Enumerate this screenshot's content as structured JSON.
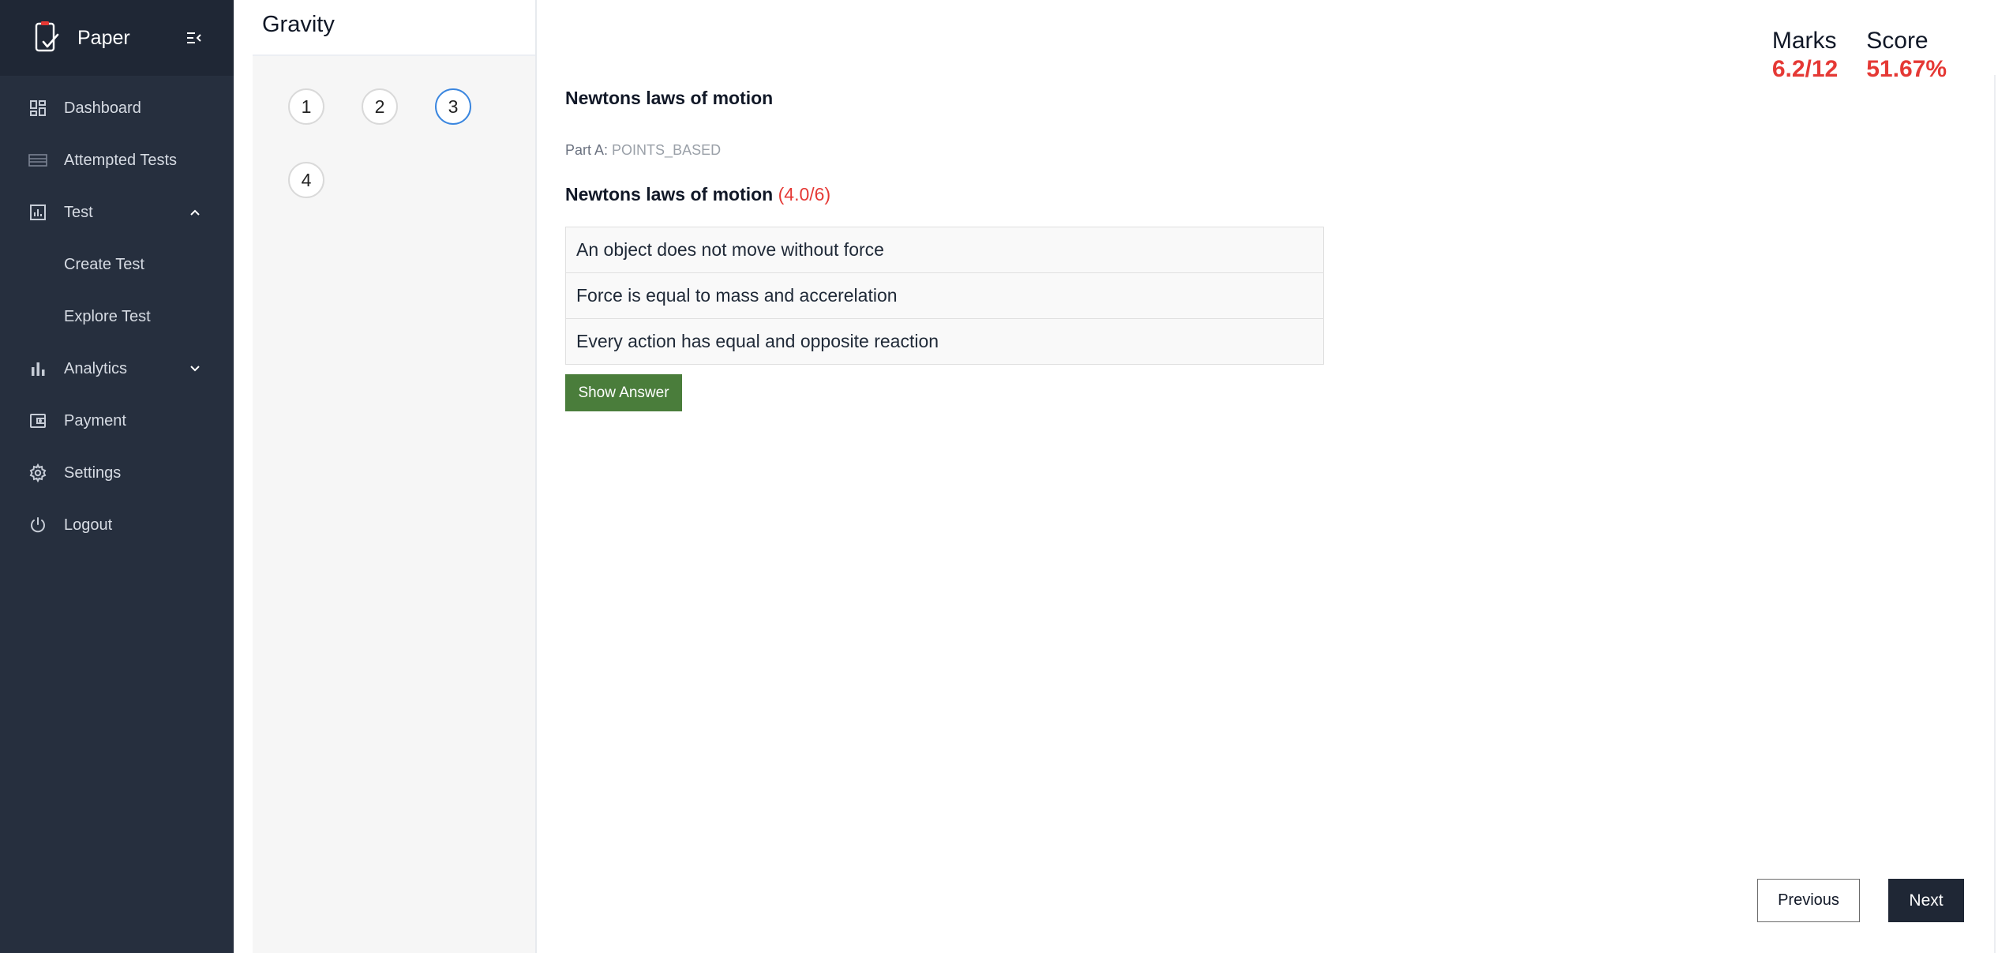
{
  "app": {
    "name": "Paper"
  },
  "sidebar": {
    "items": [
      {
        "label": "Dashboard",
        "icon": "dashboard-icon"
      },
      {
        "label": "Attempted Tests",
        "icon": "list-icon"
      },
      {
        "label": "Test",
        "icon": "bar-chart-box-icon",
        "expanded": true,
        "children": [
          {
            "label": "Create Test"
          },
          {
            "label": "Explore Test"
          }
        ]
      },
      {
        "label": "Analytics",
        "icon": "bar-chart-icon",
        "expanded": false
      },
      {
        "label": "Payment",
        "icon": "wallet-icon"
      },
      {
        "label": "Settings",
        "icon": "gear-icon"
      },
      {
        "label": "Logout",
        "icon": "power-icon"
      }
    ]
  },
  "test": {
    "title": "Gravity",
    "questions": [
      "1",
      "2",
      "3",
      "4"
    ],
    "active_question": "3"
  },
  "stats": {
    "marks_label": "Marks",
    "marks_value": "6.2/12",
    "score_label": "Score",
    "score_value": "51.67%"
  },
  "question": {
    "title": "Newtons laws of motion",
    "part_label": "Part A:",
    "part_type": "POINTS_BASED",
    "sub_title": "Newtons laws of motion",
    "sub_marks": "(4.0/6)",
    "options": [
      "An object does not move without force",
      "Force is equal to mass and accerelation",
      "Every action has equal and opposite reaction"
    ],
    "show_answer_label": "Show Answer"
  },
  "pager": {
    "previous_label": "Previous",
    "next_label": "Next"
  },
  "colors": {
    "sidebar_bg": "#262f3e",
    "brand_bg": "#1f2735",
    "accent_red": "#e53935",
    "show_answer_green": "#4a7d3b",
    "active_ring": "#3a86df"
  }
}
